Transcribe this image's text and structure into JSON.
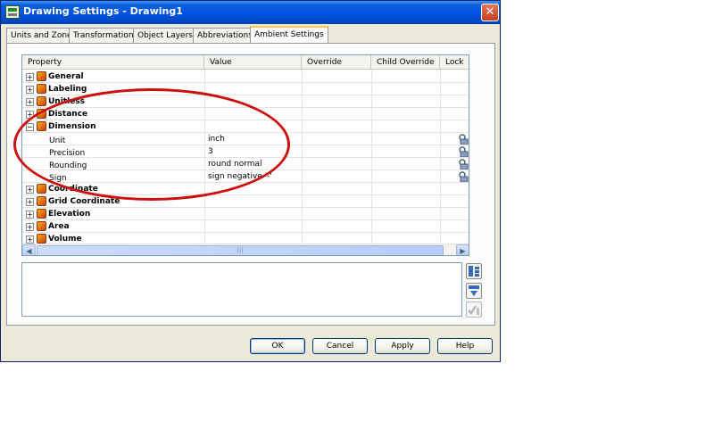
{
  "window": {
    "title": "Drawing Settings - Drawing1",
    "close_glyph": "✕"
  },
  "tabs": [
    {
      "label": "Units and Zone",
      "active": false
    },
    {
      "label": "Transformation",
      "active": false
    },
    {
      "label": "Object Layers",
      "active": false
    },
    {
      "label": "Abbreviations",
      "active": false
    },
    {
      "label": "Ambient Settings",
      "active": true
    }
  ],
  "grid": {
    "columns": [
      "Property",
      "Value",
      "Override",
      "Child Override",
      "Lock"
    ],
    "rows": [
      {
        "type": "category",
        "label": "General",
        "expander": "+"
      },
      {
        "type": "category",
        "label": "Labeling",
        "expander": "+"
      },
      {
        "type": "category",
        "label": "Unitless",
        "expander": "+"
      },
      {
        "type": "category",
        "label": "Distance",
        "expander": "+"
      },
      {
        "type": "category",
        "label": "Dimension",
        "expander": "−"
      },
      {
        "type": "property",
        "label": "Unit",
        "value": "inch",
        "locked": true
      },
      {
        "type": "property",
        "label": "Precision",
        "value": "3",
        "locked": true
      },
      {
        "type": "property",
        "label": "Rounding",
        "value": "round normal",
        "locked": true
      },
      {
        "type": "property",
        "label": "Sign",
        "value": "sign negative '-'",
        "locked": true
      },
      {
        "type": "category",
        "label": "Coordinate",
        "expander": "+"
      },
      {
        "type": "category",
        "label": "Grid Coordinate",
        "expander": "+"
      },
      {
        "type": "category",
        "label": "Elevation",
        "expander": "+"
      },
      {
        "type": "category",
        "label": "Area",
        "expander": "+"
      },
      {
        "type": "category",
        "label": "Volume",
        "expander": "+"
      }
    ]
  },
  "scroll": {
    "up": "▲",
    "down": "▼",
    "left": "◀",
    "right": "▶",
    "grip": "≡",
    "hgrip": "|||"
  },
  "buttons": {
    "ok": "OK",
    "cancel": "Cancel",
    "apply": "Apply",
    "help": "Help"
  },
  "colors": {
    "annotation": "#cc1010",
    "titlebar": "#0054e3",
    "tab_highlight": "#ffc83c"
  },
  "icons": [
    "drawing-settings-icon",
    "close-icon",
    "category-icon",
    "lock-icon",
    "expand-all-icon",
    "collapse-all-icon",
    "check-edit-icon"
  ]
}
